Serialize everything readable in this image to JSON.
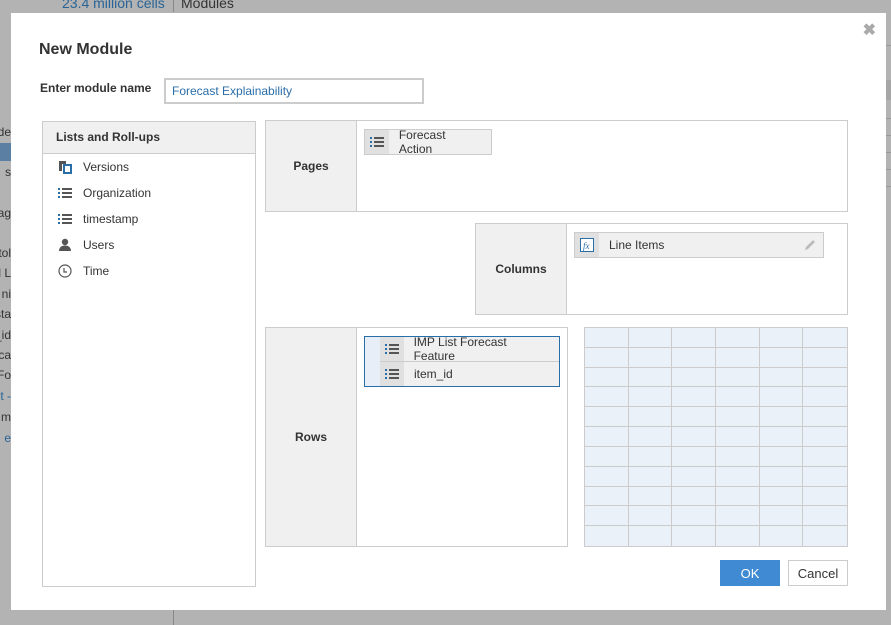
{
  "background": {
    "cells_link": "23.4 million cells",
    "modules_tab": "Modules",
    "left_fragments": [
      "de",
      "",
      "s",
      "ag",
      "tol",
      "l L",
      "ni",
      "sta",
      "_id",
      "ca",
      "Fo",
      "t -",
      "m",
      "e"
    ]
  },
  "dialog": {
    "title": "New Module",
    "close_icon": "close-x-icon",
    "module_name_label": "Enter module name",
    "module_name_value": "Forecast Explainability",
    "lists_panel": {
      "header": "Lists and Roll-ups",
      "items": [
        {
          "label": "Versions",
          "icon": "versions-icon"
        },
        {
          "label": "Organization",
          "icon": "list-icon"
        },
        {
          "label": "timestamp",
          "icon": "list-icon"
        },
        {
          "label": "Users",
          "icon": "user-icon"
        },
        {
          "label": "Time",
          "icon": "clock-icon"
        }
      ]
    },
    "pages": {
      "label": "Pages",
      "items": [
        {
          "label": "Forecast Action",
          "icon": "list-icon"
        }
      ]
    },
    "columns": {
      "label": "Columns",
      "items": [
        {
          "label": "Line Items",
          "icon": "fx-icon",
          "action_icon": "pencil-icon"
        }
      ]
    },
    "rows": {
      "label": "Rows",
      "items": [
        {
          "label": "IMP List Forecast Feature",
          "icon": "list-icon"
        },
        {
          "label": "item_id",
          "icon": "list-icon"
        }
      ]
    },
    "preview_grid": {
      "columns": 6,
      "rows": 11
    },
    "buttons": {
      "ok": "OK",
      "cancel": "Cancel"
    },
    "colors": {
      "accent": "#3f8ad2",
      "link": "#2a6ea8",
      "panel_header": "#f0f0f0",
      "grid_fill": "#ebf1f9"
    }
  }
}
